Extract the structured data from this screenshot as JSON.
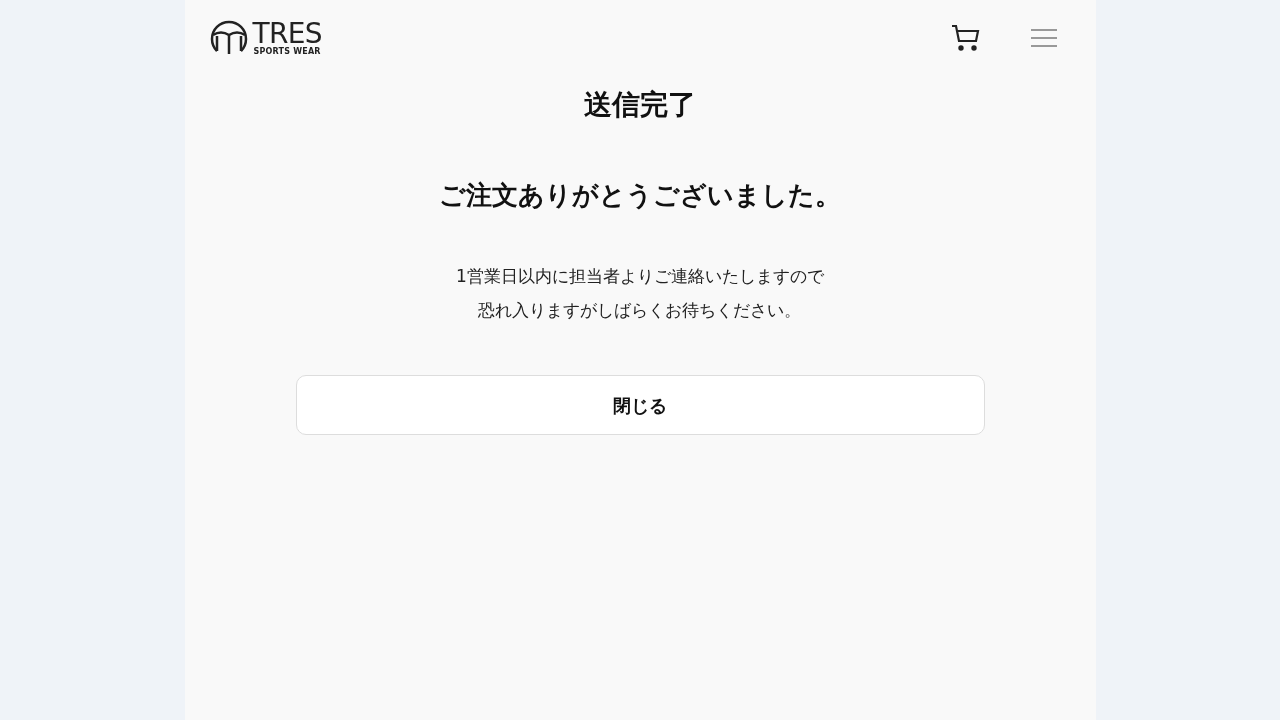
{
  "header": {
    "logo": {
      "name": "TRES",
      "tagline": "SPORTS WEAR"
    }
  },
  "title": "送信完了",
  "heading": "ご注文ありがとうございました。",
  "message_lines": [
    "1営業日以内に担当者よりご連絡いたしますので",
    "恐れ入りますがしばらくお待ちください。"
  ],
  "button": "閉じる"
}
